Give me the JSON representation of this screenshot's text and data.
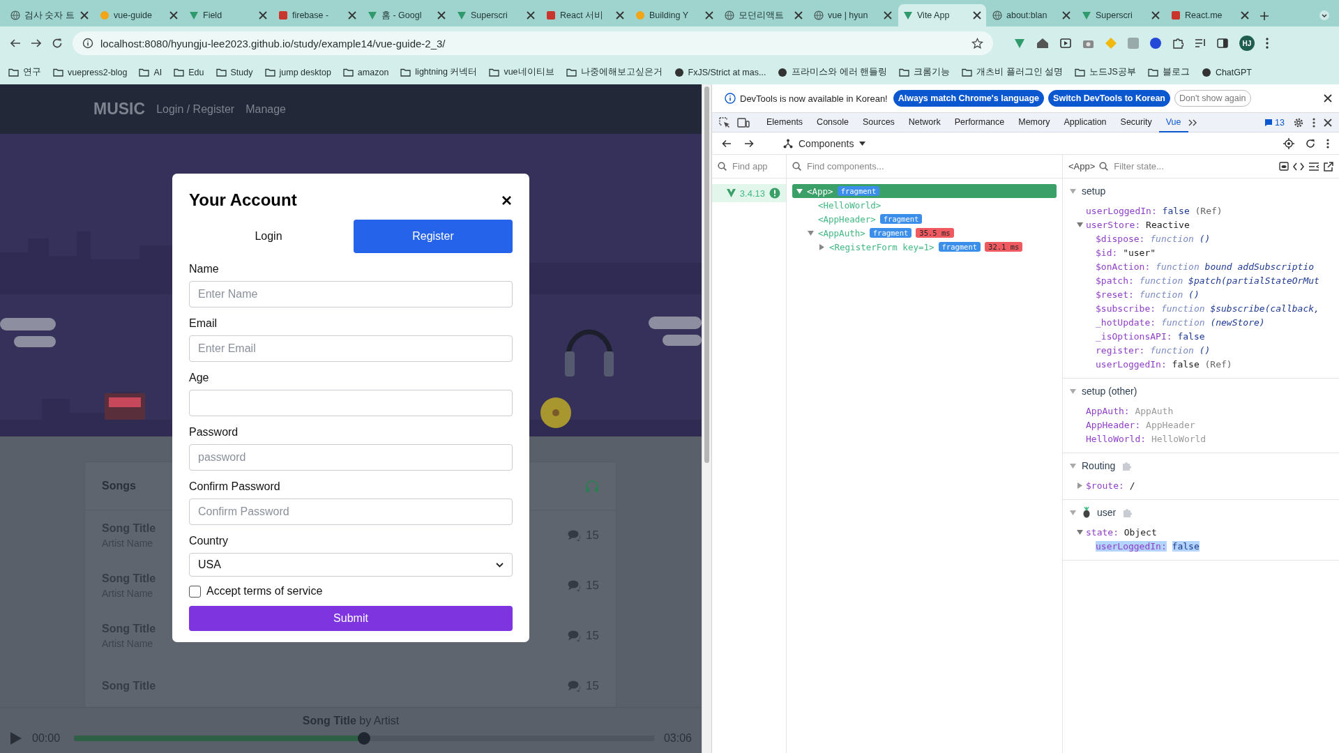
{
  "browser": {
    "tabs": [
      {
        "title": "검사 숫자 트",
        "kind": "globe",
        "selected": false
      },
      {
        "title": "vue-guide",
        "kind": "circle",
        "selected": false
      },
      {
        "title": "Field",
        "kind": "triangle",
        "selected": false
      },
      {
        "title": "firebase -",
        "kind": "square",
        "selected": false
      },
      {
        "title": "홈 - Googl",
        "kind": "triangle",
        "selected": false
      },
      {
        "title": "Superscri",
        "kind": "triangle",
        "selected": false
      },
      {
        "title": "React 서비",
        "kind": "square",
        "selected": false
      },
      {
        "title": "Building Y",
        "kind": "circle",
        "selected": false
      },
      {
        "title": "모던리액트",
        "kind": "globe",
        "selected": false
      },
      {
        "title": "vue | hyun",
        "kind": "globe",
        "selected": false
      },
      {
        "title": "Vite App",
        "kind": "triangle",
        "selected": true
      },
      {
        "title": "about:blan",
        "kind": "globe",
        "selected": false
      },
      {
        "title": "Superscri",
        "kind": "triangle",
        "selected": false
      },
      {
        "title": "React.me",
        "kind": "square",
        "selected": false
      }
    ],
    "address": "localhost:8080/hyungju-lee2023.github.io/study/example14/vue-guide-2_3/",
    "profile": "HJ",
    "bookmarks": [
      {
        "label": "연구",
        "kind": "folder"
      },
      {
        "label": "vuepress2-blog",
        "kind": "folder"
      },
      {
        "label": "AI",
        "kind": "folder"
      },
      {
        "label": "Edu",
        "kind": "folder"
      },
      {
        "label": "Study",
        "kind": "folder"
      },
      {
        "label": "jump desktop",
        "kind": "folder"
      },
      {
        "label": "amazon",
        "kind": "folder"
      },
      {
        "label": "lightning 커넥터",
        "kind": "folder"
      },
      {
        "label": "vue네이티브",
        "kind": "folder"
      },
      {
        "label": "나중에해보고싶은거",
        "kind": "folder"
      },
      {
        "label": "FxJS/Strict at mas...",
        "kind": "page"
      },
      {
        "label": "프라미스와 에러 핸들링",
        "kind": "page"
      },
      {
        "label": "크롬기능",
        "kind": "folder"
      },
      {
        "label": "개츠비 플러그인 설명",
        "kind": "folder"
      },
      {
        "label": "노드JS공부",
        "kind": "folder"
      },
      {
        "label": "블로그",
        "kind": "folder"
      },
      {
        "label": "ChatGPT",
        "kind": "page"
      }
    ]
  },
  "page": {
    "logo": "MUSIC",
    "nav": [
      "Login / Register",
      "Manage"
    ],
    "songs": {
      "title": "Songs",
      "items": [
        {
          "title": "Song Title",
          "artist": "Artist Name",
          "comments": "15"
        },
        {
          "title": "Song Title",
          "artist": "Artist Name",
          "comments": "15"
        },
        {
          "title": "Song Title",
          "artist": "Artist Name",
          "comments": "15"
        },
        {
          "title": "Song Title",
          "comments": "15"
        }
      ]
    },
    "player": {
      "title": "**Song Title** by Artist",
      "current": "00:00",
      "duration": "03:06",
      "level": 0.5
    },
    "modal": {
      "title": "Your Account",
      "tabs": [
        {
          "label": "Login",
          "selected": false
        },
        {
          "label": "Register",
          "selected": true
        }
      ],
      "fields": [
        {
          "label": "Name",
          "kind": "input",
          "placeholder": "Enter Name"
        },
        {
          "label": "Email",
          "kind": "input",
          "placeholder": "Enter Email"
        },
        {
          "label": "Age",
          "kind": "input"
        },
        {
          "label": "Password",
          "kind": "input",
          "placeholder": "password"
        },
        {
          "label": "Confirm Password",
          "kind": "input",
          "placeholder": "Confirm Password"
        },
        {
          "label": "Country",
          "kind": "select",
          "value": "USA"
        }
      ],
      "terms": {
        "label": "Accept terms of service",
        "checked": false
      },
      "submit": "Submit"
    }
  },
  "devtools": {
    "notice": {
      "text": "DevTools is now available in Korean!",
      "buttons": [
        {
          "label": "Always match Chrome's language",
          "kind": "primary"
        },
        {
          "label": "Switch DevTools to Korean",
          "kind": "primary"
        },
        {
          "label": "Don't show again",
          "kind": "outline"
        }
      ]
    },
    "tabs": [
      {
        "label": "Elements",
        "selected": false
      },
      {
        "label": "Console",
        "selected": false
      },
      {
        "label": "Sources",
        "selected": false
      },
      {
        "label": "Network",
        "selected": false
      },
      {
        "label": "Performance",
        "selected": false
      },
      {
        "label": "Memory",
        "selected": false
      },
      {
        "label": "Application",
        "selected": false
      },
      {
        "label": "Security",
        "selected": false
      },
      {
        "label": "Vue",
        "selected": true
      }
    ],
    "messages": "13",
    "view": "Components",
    "apps_search": {
      "placeholder": "Find app"
    },
    "components_search": {
      "placeholder": "Find components..."
    },
    "state_search": {
      "placeholder": "Filter state..."
    },
    "inspected": "<App>",
    "apps": [
      {
        "version": "3.4.13",
        "selected": true
      }
    ],
    "tree": [
      {
        "tag": "<App>",
        "selected": true,
        "expanded": true,
        "badges": [
          {
            "text": "fragment",
            "kind": "fragment"
          }
        ],
        "children": [
          {
            "tag": "<HelloWorld>",
            "selected": false
          },
          {
            "tag": "<AppHeader>",
            "selected": false,
            "badges": [
              {
                "text": "fragment",
                "kind": "fragment"
              }
            ]
          },
          {
            "tag": "<AppAuth>",
            "selected": false,
            "expanded": true,
            "badges": [
              {
                "text": "fragment",
                "kind": "fragment"
              },
              {
                "text": "35.5 ms",
                "kind": "time"
              }
            ],
            "children": [
              {
                "tag": "<RegisterForm key=1>",
                "selected": false,
                "expanded": false,
                "badges": [
                  {
                    "text": "fragment",
                    "kind": "fragment"
                  },
                  {
                    "text": "32.1 ms",
                    "kind": "time"
                  }
                ]
              }
            ]
          }
        ]
      }
    ],
    "sections": [
      {
        "title": "setup",
        "expanded": true,
        "plugin": false,
        "store": false,
        "rows": [
          {
            "key": "userLoggedIn:",
            "value": "false",
            "kind": "bool",
            "note": "(Ref)"
          },
          {
            "key": "userStore:",
            "value": "Reactive",
            "kind": "type",
            "expanded": true,
            "children": [
              {
                "key": "$dispose:",
                "value": "function",
                "kind": "fn",
                "detail": "()"
              },
              {
                "key": "$id:",
                "value": "\"user\"",
                "kind": "string"
              },
              {
                "key": "$onAction:",
                "value": "function",
                "kind": "fn",
                "detail": "bound addSubscriptio"
              },
              {
                "key": "$patch:",
                "value": "function",
                "kind": "fn",
                "detail": "$patch(partialStateOrMut"
              },
              {
                "key": "$reset:",
                "value": "function",
                "kind": "fn",
                "detail": "()"
              },
              {
                "key": "$subscribe:",
                "value": "function",
                "kind": "fn",
                "detail": "$subscribe(callback,"
              },
              {
                "key": "_hotUpdate:",
                "value": "function",
                "kind": "fn",
                "detail": "(newStore)"
              },
              {
                "key": "_isOptionsAPI:",
                "value": "false",
                "kind": "bool"
              },
              {
                "key": "register:",
                "value": "function",
                "kind": "fn",
                "detail": "()"
              },
              {
                "key": "userLoggedIn:",
                "value": "false",
                "kind": "plain",
                "note": "(Ref)"
              }
            ]
          }
        ]
      },
      {
        "title": "setup (other)",
        "expanded": true,
        "plugin": false,
        "store": false,
        "rows": [
          {
            "key": "AppAuth:",
            "value": "AppAuth",
            "kind": "component"
          },
          {
            "key": "AppHeader:",
            "value": "AppHeader",
            "kind": "component"
          },
          {
            "key": "HelloWorld:",
            "value": "HelloWorld",
            "kind": "component"
          }
        ]
      },
      {
        "title": "Routing",
        "expanded": true,
        "plugin": true,
        "store": false,
        "rows": [
          {
            "key": "$route:",
            "value": "/",
            "kind": "plain",
            "expanded": false
          }
        ]
      },
      {
        "title": "user",
        "expanded": true,
        "plugin": true,
        "store": true,
        "rows": [
          {
            "key": "state:",
            "value": "Object",
            "kind": "type",
            "expanded": true,
            "children": [
              {
                "key": "userLoggedIn:",
                "value": "false",
                "kind": "bool",
                "highlighted": true
              }
            ]
          }
        ]
      }
    ]
  }
}
